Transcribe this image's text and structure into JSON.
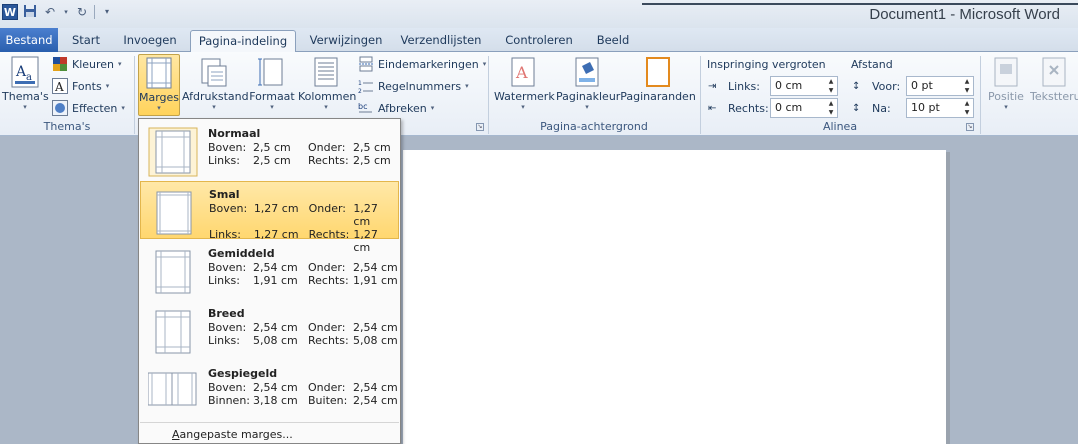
{
  "app": {
    "title": "Document1 - Microsoft Word"
  },
  "qat": {
    "logo": "W",
    "icons": [
      "word-logo-icon",
      "save-icon",
      "undo-icon",
      "redo-icon",
      "customize-icon"
    ]
  },
  "tabs": [
    "Bestand",
    "Start",
    "Invoegen",
    "Pagina-indeling",
    "Verwijzingen",
    "Verzendlijsten",
    "Controleren",
    "Beeld"
  ],
  "ribbon": {
    "themes": {
      "themes_label": "Thema's",
      "colors": "Kleuren",
      "fonts": "Fonts",
      "effects": "Effecten",
      "group": "Thema's"
    },
    "page_setup": {
      "margins": "Marges",
      "orientation": "Afdrukstand",
      "size": "Formaat",
      "columns": "Kolommen",
      "breaks": "Eindemarkeringen",
      "line_numbers": "Regelnummers",
      "hyphenation": "Afbreken"
    },
    "background": {
      "watermark": "Watermerk",
      "page_color": "Paginakleur",
      "page_borders": "Paginaranden",
      "group": "Pagina-achtergrond"
    },
    "paragraph": {
      "indent_title": "Inspringing vergroten",
      "left_label": "Links:",
      "left_value": "0 cm",
      "right_label": "Rechts:",
      "right_value": "0 cm",
      "spacing_title": "Afstand",
      "before_label": "Voor:",
      "before_value": "0 pt",
      "after_label": "Na:",
      "after_value": "10 pt",
      "group": "Alinea"
    },
    "arrange": {
      "position": "Positie",
      "wrap_text": "Tekstteruc"
    }
  },
  "margins_menu": {
    "options": [
      {
        "name": "Normaal",
        "l1": "Boven:",
        "v1": "2,5 cm",
        "l2": "Onder:",
        "v2": "2,5 cm",
        "l3": "Links:",
        "v3": "2,5 cm",
        "l4": "Rechts:",
        "v4": "2,5 cm"
      },
      {
        "name": "Smal",
        "l1": "Boven:",
        "v1": "1,27 cm",
        "l2": "Onder:",
        "v2": "1,27 cm",
        "l3": "Links:",
        "v3": "1,27 cm",
        "l4": "Rechts:",
        "v4": "1,27 cm"
      },
      {
        "name": "Gemiddeld",
        "l1": "Boven:",
        "v1": "2,54 cm",
        "l2": "Onder:",
        "v2": "2,54 cm",
        "l3": "Links:",
        "v3": "1,91 cm",
        "l4": "Rechts:",
        "v4": "1,91 cm"
      },
      {
        "name": "Breed",
        "l1": "Boven:",
        "v1": "2,54 cm",
        "l2": "Onder:",
        "v2": "2,54 cm",
        "l3": "Links:",
        "v3": "5,08 cm",
        "l4": "Rechts:",
        "v4": "5,08 cm"
      },
      {
        "name": "Gespiegeld",
        "l1": "Boven:",
        "v1": "2,54 cm",
        "l2": "Onder:",
        "v2": "2,54 cm",
        "l3": "Binnen:",
        "v3": "3,18 cm",
        "l4": "Buiten:",
        "v4": "2,54 cm"
      }
    ],
    "selected": "Smal",
    "custom_label_underlined": "A",
    "custom_label_rest": "angepaste marges..."
  }
}
